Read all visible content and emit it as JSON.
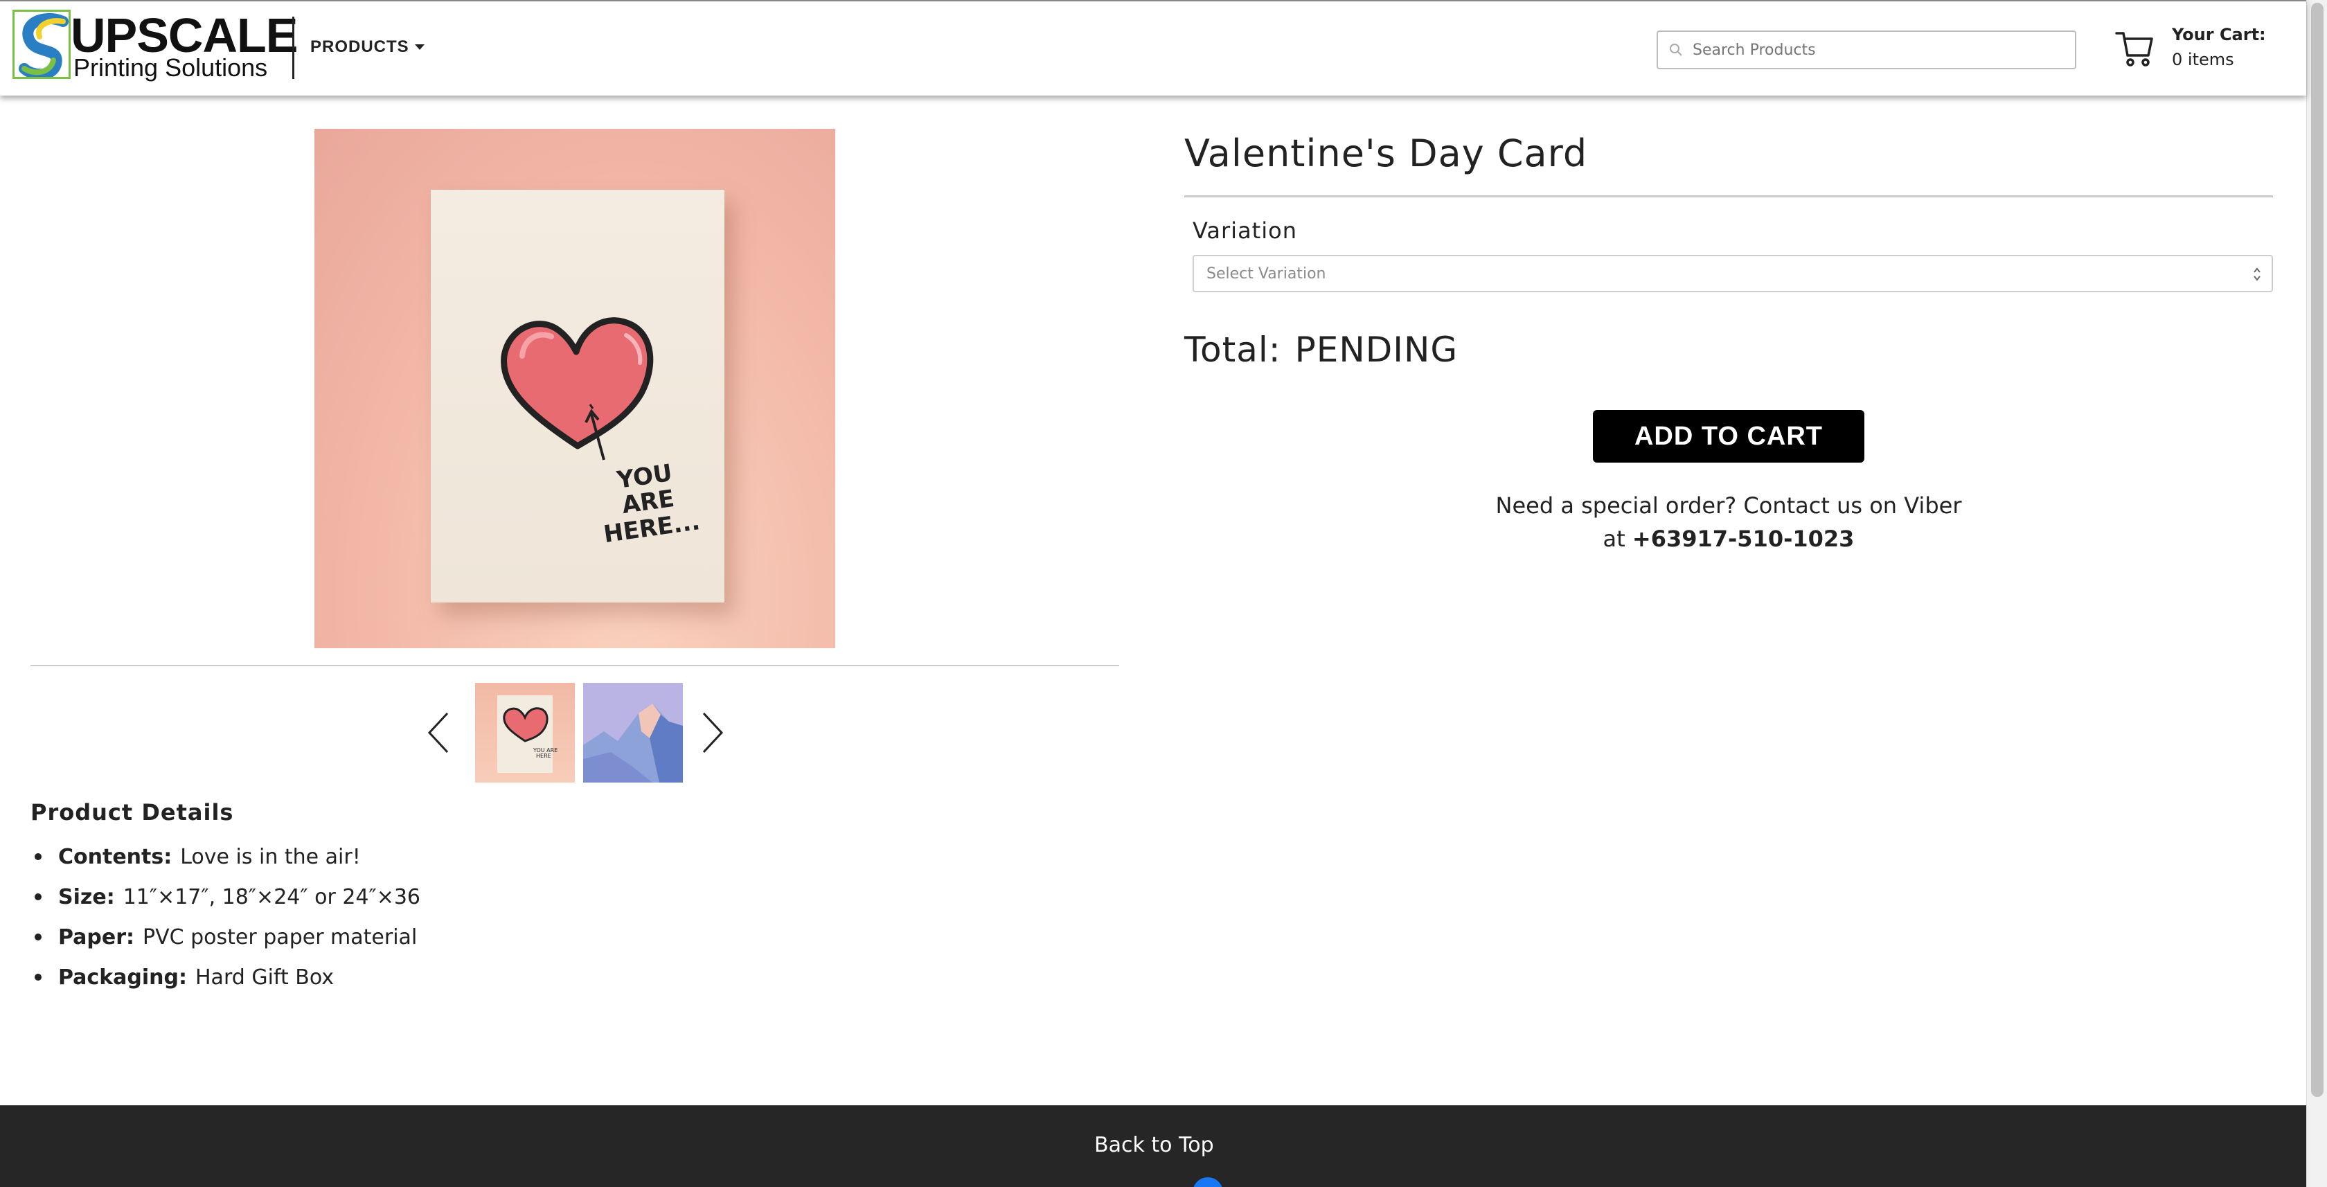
{
  "header": {
    "logo_title": "UPSCALE",
    "logo_subtitle": "Printing Solutions",
    "products_label": "PRODUCTS",
    "search_placeholder": "Search Products",
    "cart_label": "Your Cart:",
    "cart_count": "0 items"
  },
  "product": {
    "title": "Valentine's Day Card",
    "card_text": "YOU ARE HERE...",
    "variation_label": "Variation",
    "variation_placeholder": "Select Variation",
    "total_label": "Total:",
    "total_value": "PENDING",
    "add_to_cart_label": "ADD TO CART",
    "special_order_line1": "Need a special order? Contact us on Viber",
    "special_order_at": "at",
    "special_order_phone": "+63917-510-1023"
  },
  "details": {
    "title": "Product Details",
    "items": [
      {
        "key": "Contents:",
        "value": "Love is in the air!"
      },
      {
        "key": "Size:",
        "value": "11″×17″, 18″×24″ or 24″×36"
      },
      {
        "key": "Paper:",
        "value": "PVC poster paper material"
      },
      {
        "key": "Packaging:",
        "value": "Hard Gift Box"
      }
    ]
  },
  "footer": {
    "back_to_top": "Back to Top"
  },
  "colors": {
    "accent_black": "#000000",
    "footer_bg": "#262626",
    "logo_green": "#7bbf44",
    "logo_blue": "#2a7fc4"
  }
}
